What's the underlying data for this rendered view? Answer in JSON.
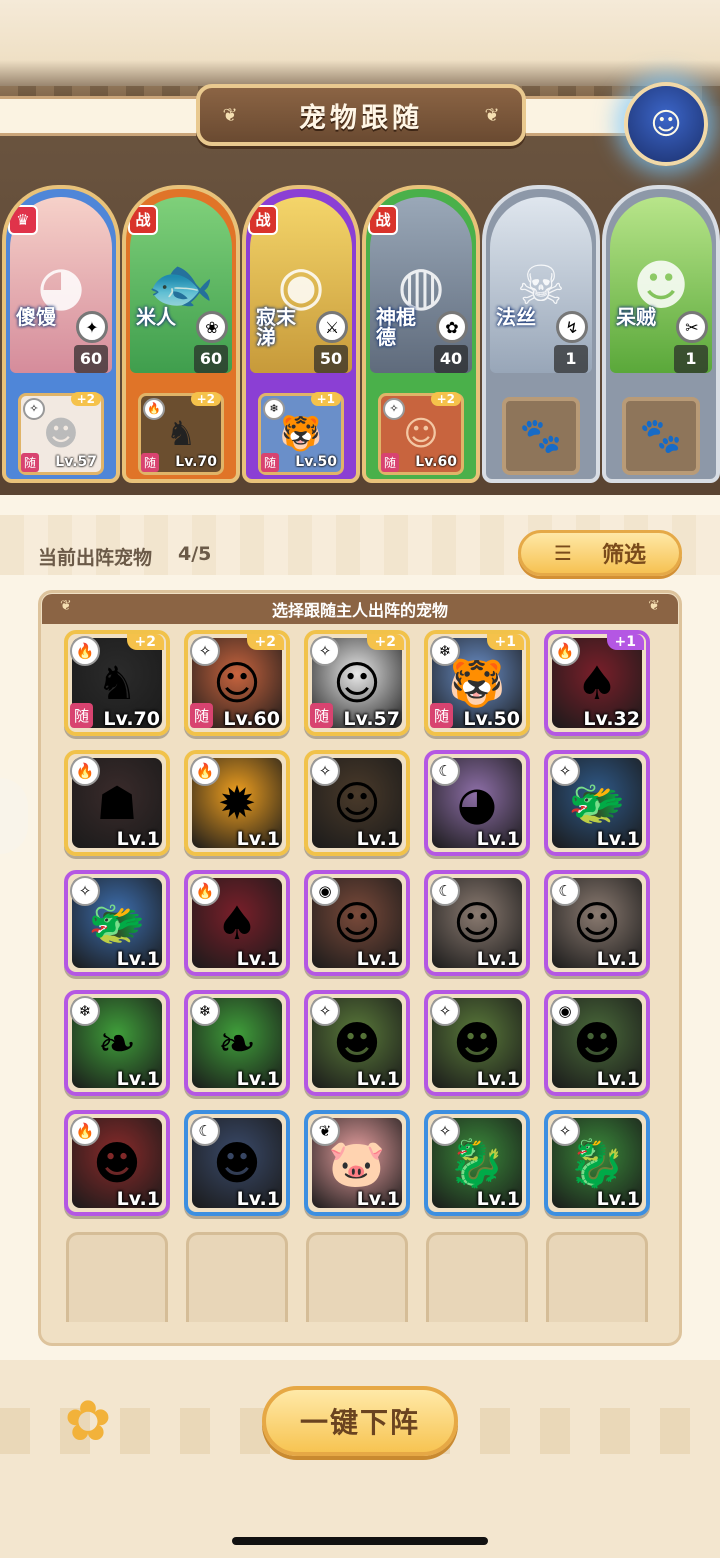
{
  "title": "宠物跟随",
  "heroes": [
    {
      "badge": "♛",
      "name": "傻馒",
      "level": "60",
      "icon": "crown-icon",
      "slot": {
        "plus": "+2",
        "follow": "随",
        "level": "Lv.57"
      }
    },
    {
      "badge": "战",
      "name": "米人",
      "level": "60",
      "icon": "battle-icon",
      "slot": {
        "plus": "+2",
        "follow": "随",
        "level": "Lv.70"
      }
    },
    {
      "badge": "战",
      "name": "寂末涕",
      "level": "50",
      "icon": "battle-icon",
      "slot": {
        "plus": "+1",
        "follow": "随",
        "level": "Lv.50"
      }
    },
    {
      "badge": "战",
      "name": "神棍德",
      "level": "40",
      "icon": "battle-icon",
      "slot": {
        "plus": "+2",
        "follow": "随",
        "level": "Lv.60"
      }
    },
    {
      "badge": "",
      "name": "法丝",
      "level": "1",
      "icon": "",
      "slot": null
    },
    {
      "badge": "",
      "name": "呆贼",
      "level": "1",
      "icon": "",
      "slot": null
    }
  ],
  "deploy": {
    "label": "当前出阵宠物",
    "count": "4/5"
  },
  "filter_button": "筛选",
  "grid_title": "选择跟随主人出阵的宠物",
  "pets": [
    {
      "level": "Lv.70",
      "plus": "+2",
      "follow": "随",
      "frame": "gold"
    },
    {
      "level": "Lv.60",
      "plus": "+2",
      "follow": "随",
      "frame": "gold"
    },
    {
      "level": "Lv.57",
      "plus": "+2",
      "follow": "随",
      "frame": "gold"
    },
    {
      "level": "Lv.50",
      "plus": "+1",
      "follow": "随",
      "frame": "gold"
    },
    {
      "level": "Lv.32",
      "plus": "+1",
      "follow": "",
      "frame": "purple"
    },
    {
      "level": "Lv.1",
      "plus": "",
      "follow": "",
      "frame": "gold"
    },
    {
      "level": "Lv.1",
      "plus": "",
      "follow": "",
      "frame": "gold"
    },
    {
      "level": "Lv.1",
      "plus": "",
      "follow": "",
      "frame": "gold"
    },
    {
      "level": "Lv.1",
      "plus": "",
      "follow": "",
      "frame": "purple"
    },
    {
      "level": "Lv.1",
      "plus": "",
      "follow": "",
      "frame": "purple"
    },
    {
      "level": "Lv.1",
      "plus": "",
      "follow": "",
      "frame": "purple"
    },
    {
      "level": "Lv.1",
      "plus": "",
      "follow": "",
      "frame": "purple"
    },
    {
      "level": "Lv.1",
      "plus": "",
      "follow": "",
      "frame": "purple"
    },
    {
      "level": "Lv.1",
      "plus": "",
      "follow": "",
      "frame": "purple"
    },
    {
      "level": "Lv.1",
      "plus": "",
      "follow": "",
      "frame": "purple"
    },
    {
      "level": "Lv.1",
      "plus": "",
      "follow": "",
      "frame": "purple"
    },
    {
      "level": "Lv.1",
      "plus": "",
      "follow": "",
      "frame": "purple"
    },
    {
      "level": "Lv.1",
      "plus": "",
      "follow": "",
      "frame": "purple"
    },
    {
      "level": "Lv.1",
      "plus": "",
      "follow": "",
      "frame": "purple"
    },
    {
      "level": "Lv.1",
      "plus": "",
      "follow": "",
      "frame": "purple"
    },
    {
      "level": "Lv.1",
      "plus": "",
      "follow": "",
      "frame": "purple"
    },
    {
      "level": "Lv.1",
      "plus": "",
      "follow": "",
      "frame": "blue"
    },
    {
      "level": "Lv.1",
      "plus": "",
      "follow": "",
      "frame": "blue"
    },
    {
      "level": "Lv.1",
      "plus": "",
      "follow": "",
      "frame": "blue"
    },
    {
      "level": "Lv.1",
      "plus": "",
      "follow": "",
      "frame": "blue"
    }
  ],
  "main_button": "一键下阵"
}
